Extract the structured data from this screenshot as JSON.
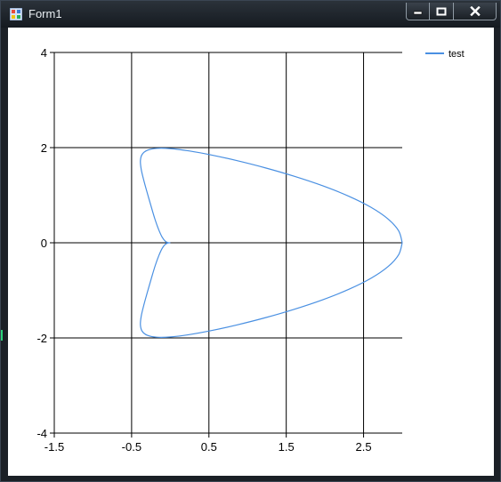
{
  "window": {
    "title": "Form1"
  },
  "colors": {
    "series": "#4a90e2",
    "grid": "#000000",
    "background": "#ffffff",
    "frame": "#1b2026"
  },
  "icons": {
    "app": "app-icon",
    "minimize": "minimize-icon",
    "maximize": "maximize-icon",
    "close": "close-icon"
  },
  "chart_data": {
    "type": "line",
    "title": "",
    "xlabel": "",
    "ylabel": "",
    "xlim": [
      -1.5,
      3
    ],
    "ylim": [
      -4,
      4
    ],
    "x_ticks": [
      -1.5,
      -0.5,
      0.5,
      1.5,
      2.5
    ],
    "y_ticks": [
      4,
      2,
      0,
      -2,
      -4
    ],
    "x_tick_labels": [
      "-1.5",
      "-0.5",
      "0.5",
      "1.5",
      "2.5"
    ],
    "y_tick_labels": [
      "4",
      "2",
      "0",
      "-2",
      "-4"
    ],
    "grid": true,
    "legend": {
      "position": "top-right",
      "entries": [
        "test"
      ]
    },
    "series": [
      {
        "name": "test",
        "x": [
          3.0,
          2.953,
          2.814,
          2.594,
          2.306,
          1.969,
          1.603,
          1.229,
          0.866,
          0.533,
          0.243,
          0.005,
          -0.174,
          -0.295,
          -0.363,
          -0.386,
          -0.375,
          -0.341,
          -0.295,
          -0.245,
          -0.196,
          -0.148,
          -0.104,
          -0.062,
          -0.029,
          -0.008,
          0.0
        ],
        "y": [
          0.0,
          0.253,
          0.504,
          0.748,
          0.981,
          1.199,
          1.398,
          1.575,
          1.725,
          1.845,
          1.931,
          1.979,
          1.985,
          1.946,
          1.86,
          1.725,
          1.538,
          1.304,
          1.033,
          0.751,
          0.486,
          0.27,
          0.115,
          0.029,
          0.004,
          0.0,
          0.0
        ]
      }
    ]
  }
}
